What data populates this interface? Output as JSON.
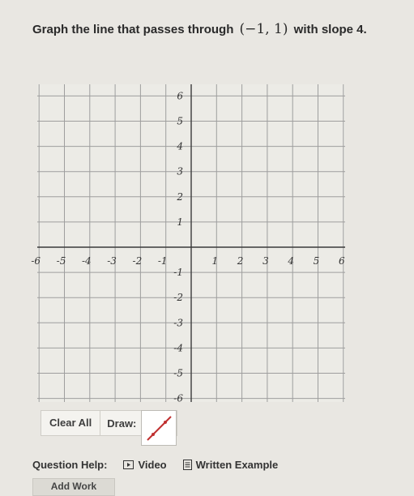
{
  "prompt": {
    "text_before": "Graph the line that passes through",
    "point": "(−1, 1)",
    "text_after": "with slope 4."
  },
  "graph": {
    "x_ticks": [
      "-6",
      "-5",
      "-4",
      "-3",
      "-2",
      "-1",
      "1",
      "2",
      "3",
      "4",
      "5",
      "6"
    ],
    "y_ticks": [
      "6",
      "5",
      "4",
      "3",
      "2",
      "1",
      "-1",
      "-2",
      "-3",
      "-4",
      "-5",
      "-6"
    ],
    "x_range": [
      -6,
      6
    ],
    "y_range": [
      -6,
      6
    ],
    "grid": true
  },
  "controls": {
    "clear_all": "Clear All",
    "draw_label": "Draw:",
    "draw_tool_icon": "line-segment-icon"
  },
  "help": {
    "label": "Question Help:",
    "video": "Video",
    "written_example": "Written Example",
    "video_icon": "play-icon",
    "example_icon": "document-icon"
  },
  "add_work": "Add Work",
  "colors": {
    "grid": "#9e9e9e",
    "axis": "#3a3a3a",
    "page_background": "#e9e7e2",
    "draw_tool_stroke": "#c03030"
  }
}
